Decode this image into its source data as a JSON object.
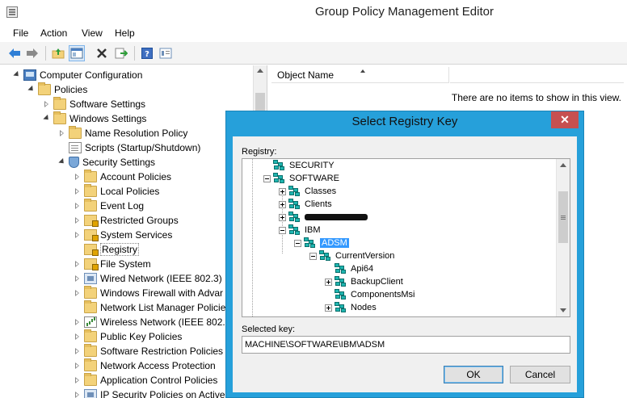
{
  "window": {
    "title": "Group Policy Management Editor"
  },
  "menu": {
    "file": "File",
    "action": "Action",
    "view": "View",
    "help": "Help"
  },
  "toolbar": {
    "buttons": [
      "back-icon",
      "forward-icon",
      "up-folder-icon",
      "show-hide-tree-icon",
      "delete-icon",
      "export-icon",
      "help-icon",
      "properties-icon"
    ]
  },
  "tree": {
    "items": [
      {
        "label": "Computer Configuration"
      },
      {
        "label": "Policies"
      },
      {
        "label": "Software Settings"
      },
      {
        "label": "Windows Settings"
      },
      {
        "label": "Name Resolution Policy"
      },
      {
        "label": "Scripts (Startup/Shutdown)"
      },
      {
        "label": "Security Settings"
      },
      {
        "label": "Account Policies"
      },
      {
        "label": "Local Policies"
      },
      {
        "label": "Event Log"
      },
      {
        "label": "Restricted Groups"
      },
      {
        "label": "System Services"
      },
      {
        "label": "Registry"
      },
      {
        "label": "File System"
      },
      {
        "label": "Wired Network (IEEE 802.3) P"
      },
      {
        "label": "Windows Firewall with Advar"
      },
      {
        "label": "Network List Manager Policie"
      },
      {
        "label": "Wireless Network (IEEE 802.1"
      },
      {
        "label": "Public Key Policies"
      },
      {
        "label": "Software Restriction Policies"
      },
      {
        "label": "Network Access Protection"
      },
      {
        "label": "Application Control Policies"
      },
      {
        "label": "IP Security Policies on Active"
      }
    ]
  },
  "list": {
    "column_object_name": "Object Name",
    "empty_message": "There are no items to show in this view."
  },
  "dialog": {
    "title": "Select Registry Key",
    "close_label": "✕",
    "registry_label": "Registry:",
    "registry_items": [
      {
        "label": "SECURITY"
      },
      {
        "label": "SOFTWARE"
      },
      {
        "label": "Classes"
      },
      {
        "label": "Clients"
      },
      {
        "label": ""
      },
      {
        "label": "IBM"
      },
      {
        "label": "ADSM"
      },
      {
        "label": "CurrentVersion"
      },
      {
        "label": "Api64"
      },
      {
        "label": "BackupClient"
      },
      {
        "label": "ComponentsMsi"
      },
      {
        "label": "Nodes"
      }
    ],
    "selected_key_label": "Selected key:",
    "selected_key_value": "MACHINE\\SOFTWARE\\IBM\\ADSM",
    "ok_label": "OK",
    "cancel_label": "Cancel"
  }
}
